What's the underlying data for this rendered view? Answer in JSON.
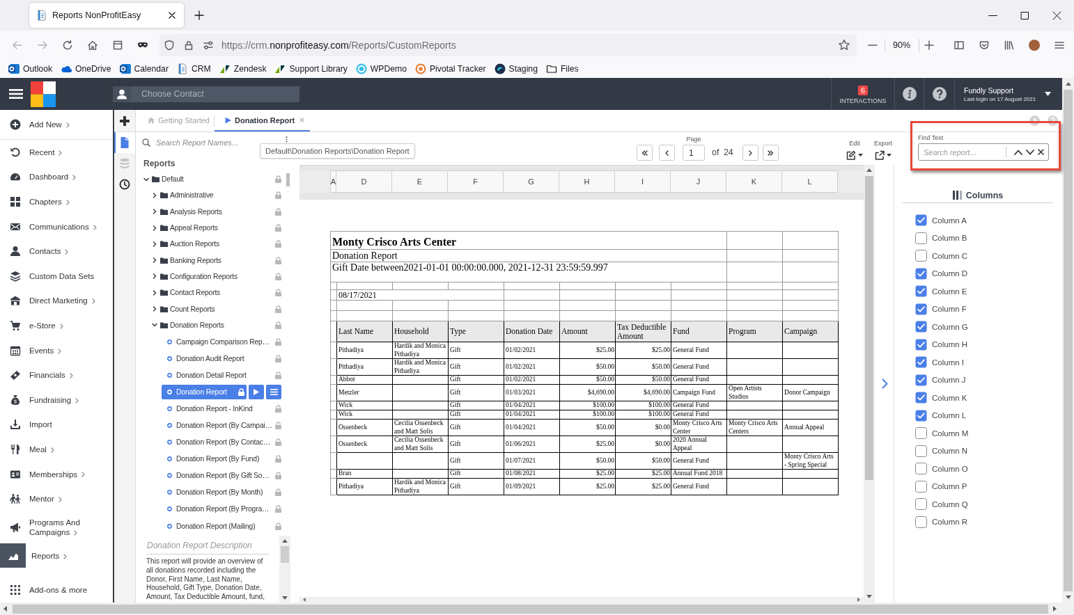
{
  "browser": {
    "tab_title": "Reports NonProfitEasy",
    "url": {
      "host_prefix": "https://crm.",
      "domain": "nonprofiteasy.com",
      "path": "/Reports/CustomReports"
    },
    "zoom": "90%",
    "bookmarks": [
      {
        "label": "Outlook",
        "kind": "outlook"
      },
      {
        "label": "OneDrive",
        "kind": "onedrive"
      },
      {
        "label": "Calendar",
        "kind": "outlook"
      },
      {
        "label": "CRM",
        "kind": "page"
      },
      {
        "label": "Zendesk",
        "kind": "zendesk"
      },
      {
        "label": "Support Library",
        "kind": "zendesk"
      },
      {
        "label": "WPDemo",
        "kind": "wpdemo"
      },
      {
        "label": "Pivotal Tracker",
        "kind": "pivotal"
      },
      {
        "label": "Staging",
        "kind": "staging"
      },
      {
        "label": "Files",
        "kind": "folder"
      }
    ]
  },
  "header": {
    "contact_placeholder": "Choose Contact",
    "interactions": {
      "count": "6",
      "label": "INTERACTIONS"
    },
    "user": {
      "name": "Fundly Support",
      "last_login": "Last login on 17 August 2021"
    }
  },
  "sidebar": {
    "items": [
      {
        "label": "Add New",
        "kind": "add",
        "submenu": true,
        "selected": false
      },
      {
        "label": "Recent",
        "kind": "recent",
        "submenu": true,
        "selected": false
      },
      {
        "label": "Dashboard",
        "kind": "dashboard",
        "submenu": true,
        "selected": false
      },
      {
        "label": "Chapters",
        "kind": "chapters",
        "submenu": true,
        "selected": false
      },
      {
        "label": "Communications",
        "kind": "communications",
        "submenu": true,
        "selected": false
      },
      {
        "label": "Contacts",
        "kind": "contacts",
        "submenu": true,
        "selected": false
      },
      {
        "label": "Custom Data Sets",
        "kind": "datasets",
        "submenu": false,
        "selected": false
      },
      {
        "label": "Direct Marketing",
        "kind": "marketing",
        "submenu": true,
        "selected": false
      },
      {
        "label": "e-Store",
        "kind": "estore",
        "submenu": true,
        "selected": false
      },
      {
        "label": "Events",
        "kind": "events",
        "submenu": true,
        "selected": false
      },
      {
        "label": "Financials",
        "kind": "financials",
        "submenu": true,
        "selected": false
      },
      {
        "label": "Fundraising",
        "kind": "fundraising",
        "submenu": true,
        "selected": false
      },
      {
        "label": "Import",
        "kind": "import",
        "submenu": false,
        "selected": false
      },
      {
        "label": "Meal",
        "kind": "meal",
        "submenu": true,
        "selected": false
      },
      {
        "label": "Memberships",
        "kind": "memberships",
        "submenu": true,
        "selected": false
      },
      {
        "label": "Mentor",
        "kind": "mentor",
        "submenu": true,
        "selected": false
      },
      {
        "label": "Programs And Campaigns",
        "kind": "programs",
        "submenu": true,
        "selected": false
      },
      {
        "label": "Reports",
        "kind": "reports",
        "submenu": true,
        "selected": true
      },
      {
        "label": "Add-ons & more",
        "kind": "addons",
        "submenu": false,
        "selected": false
      }
    ]
  },
  "tool_strip": [
    {
      "kind": "add",
      "selected": false,
      "disabled": false
    },
    {
      "kind": "report",
      "selected": true,
      "disabled": false
    },
    {
      "kind": "database",
      "selected": false,
      "disabled": true
    },
    {
      "kind": "history",
      "selected": false,
      "disabled": false
    }
  ],
  "tabs": [
    {
      "label": "Getting Started",
      "kind": "home",
      "selected": false,
      "closable": false
    },
    {
      "label": "Donation Report",
      "kind": "report",
      "selected": true,
      "closable": true
    }
  ],
  "tooltip": "Default\\Donation Reports\\Donation Report",
  "report_list": {
    "search": {
      "placeholder": "Search Report Names..."
    },
    "heading": "Reports",
    "tree": [
      {
        "label": "Default",
        "kind": "folder",
        "expanded": true,
        "children": [
          {
            "label": "Administrative",
            "kind": "folder",
            "expanded": false
          },
          {
            "label": "Analysis Reports",
            "kind": "folder",
            "expanded": false
          },
          {
            "label": "Appeal Reports",
            "kind": "folder",
            "expanded": false
          },
          {
            "label": "Auction Reports",
            "kind": "folder",
            "expanded": false
          },
          {
            "label": "Banking Reports",
            "kind": "folder",
            "expanded": false
          },
          {
            "label": "Configuration Reports",
            "kind": "folder",
            "expanded": false
          },
          {
            "label": "Contact Reports",
            "kind": "folder",
            "expanded": false
          },
          {
            "label": "Count Reports",
            "kind": "folder",
            "expanded": false
          },
          {
            "label": "Donation Reports",
            "kind": "folder",
            "expanded": true,
            "children": [
              {
                "label": "Campaign Comparison Rep…",
                "kind": "report",
                "selected": false
              },
              {
                "label": "Donation Audit Report",
                "kind": "report",
                "selected": false
              },
              {
                "label": "Donation Detail Report",
                "kind": "report",
                "selected": false
              },
              {
                "label": "Donation Report",
                "kind": "report",
                "selected": true
              },
              {
                "label": "Donation Report - InKind",
                "kind": "report",
                "selected": false
              },
              {
                "label": "Donation Report (By Campai…",
                "kind": "report",
                "selected": false
              },
              {
                "label": "Donation Report (By Contac…",
                "kind": "report",
                "selected": false
              },
              {
                "label": "Donation Report (By Fund)",
                "kind": "report",
                "selected": false
              },
              {
                "label": "Donation Report (By Gift So…",
                "kind": "report",
                "selected": false
              },
              {
                "label": "Donation Report (By Month)",
                "kind": "report",
                "selected": false
              },
              {
                "label": "Donation Report (By Progra…",
                "kind": "report",
                "selected": false
              },
              {
                "label": "Donation Report (Mailing)",
                "kind": "report",
                "selected": false
              }
            ]
          }
        ]
      }
    ],
    "description": {
      "title": "Donation Report Description",
      "text": "This report will provide an overview of all donations recorded including the Donor, First Name, Last Name, Household, Gift Type, Donation Date, Amount, Tax Deductible Amount, fund,"
    }
  },
  "viewer": {
    "page": {
      "label": "Page",
      "value": "1",
      "total": "of 24"
    },
    "edit_label": "Edit",
    "export_label": "Export",
    "grid_columns": [
      "A",
      "D",
      "E",
      "F",
      "G",
      "H",
      "I",
      "J",
      "K",
      "L"
    ],
    "report": {
      "title": "Monty Crisco Arts Center",
      "subtitle": "Donation Report",
      "filter": "Gift Date between2021-01-01 00:00:00.000, 2021-12-31 23:59:59.997",
      "run_date": "08/17/2021",
      "columns": [
        "Last Name",
        "Household",
        "Type",
        "Donation Date",
        "Amount",
        "Tax Deductible Amount",
        "Fund",
        "Program",
        "Campaign"
      ],
      "rows": [
        {
          "last_name": "Pithadiya",
          "household": "Hardik and Monica Pithadiya",
          "type": "Gift",
          "donation_date": "01/02/2021",
          "amount": "$25.00",
          "tax_deductible_amount": "$25.00",
          "fund": "General Fund"
        },
        {
          "last_name": "Pithadiya",
          "household": "Hardik and Monica Pithadiya",
          "type": "Gift",
          "donation_date": "01/02/2021",
          "amount": "$50.00",
          "tax_deductible_amount": "$50.00",
          "fund": "General Fund"
        },
        {
          "last_name": "Abbot",
          "type": "Gift",
          "donation_date": "01/02/2021",
          "amount": "$50.00",
          "tax_deductible_amount": "$50.00",
          "fund": "General Fund"
        },
        {
          "last_name": "Metzler",
          "type": "Gift",
          "donation_date": "01/03/2021",
          "amount": "$4,690.00",
          "tax_deductible_amount": "$4,690.00",
          "fund": "Campaign Fund",
          "program": "Open Artists Studios",
          "campaign": "Donor Campaign"
        },
        {
          "last_name": "Wick",
          "type": "Gift",
          "donation_date": "01/04/2021",
          "amount": "$100.00",
          "tax_deductible_amount": "$100.00",
          "fund": "General Fund"
        },
        {
          "last_name": "Wick",
          "type": "Gift",
          "donation_date": "01/04/2021",
          "amount": "$100.00",
          "tax_deductible_amount": "$100.00",
          "fund": "General Fund"
        },
        {
          "last_name": "Ossenbeck",
          "household": "Cecilia Ossenbeck and Matt Solis",
          "type": "Gift",
          "donation_date": "01/04/2021",
          "amount": "$50.00",
          "tax_deductible_amount": "$0.00",
          "fund": "Monty Crisco Arts Center",
          "program": "Monty Crisco Arts Centers",
          "campaign": "Annual Appeal"
        },
        {
          "last_name": "Ossenbeck",
          "household": "Cecilia Ossenbeck and Matt Solis",
          "type": "Gift",
          "donation_date": "01/06/2021",
          "amount": "$25.00",
          "tax_deductible_amount": "$0.00",
          "fund": "2020 Annual Appeal"
        },
        {
          "type": "Gift",
          "donation_date": "01/07/2021",
          "amount": "$50.00",
          "tax_deductible_amount": "$50.00",
          "fund": "General Fund",
          "campaign": "Monty Crisco Arts - Spring Special"
        },
        {
          "last_name": "Bran",
          "type": "Gift",
          "donation_date": "01/08/2021",
          "amount": "$25.00",
          "tax_deductible_amount": "$25.00",
          "fund": "Annual Fund 2018"
        },
        {
          "last_name": "Pithadiya",
          "household": "Hardik and Monica Pithadiya",
          "type": "Gift",
          "donation_date": "01/09/2021",
          "amount": "$25.00",
          "tax_deductible_amount": "$25.00",
          "fund": "General Fund"
        }
      ]
    }
  },
  "right_panel": {
    "find": {
      "label": "Find Text",
      "placeholder": "Search report..."
    },
    "columns_title": "Columns",
    "columns": [
      {
        "label": "Column A",
        "checked": true
      },
      {
        "label": "Column B",
        "checked": false
      },
      {
        "label": "Column C",
        "checked": false
      },
      {
        "label": "Column D",
        "checked": true
      },
      {
        "label": "Column E",
        "checked": true
      },
      {
        "label": "Column F",
        "checked": true
      },
      {
        "label": "Column G",
        "checked": true
      },
      {
        "label": "Column H",
        "checked": true
      },
      {
        "label": "Column I",
        "checked": true
      },
      {
        "label": "Column J",
        "checked": true
      },
      {
        "label": "Column K",
        "checked": true
      },
      {
        "label": "Column L",
        "checked": true
      },
      {
        "label": "Column M",
        "checked": false
      },
      {
        "label": "Column N",
        "checked": false
      },
      {
        "label": "Column O",
        "checked": false
      },
      {
        "label": "Column P",
        "checked": false
      },
      {
        "label": "Column Q",
        "checked": false
      },
      {
        "label": "Column R",
        "checked": false
      }
    ]
  }
}
